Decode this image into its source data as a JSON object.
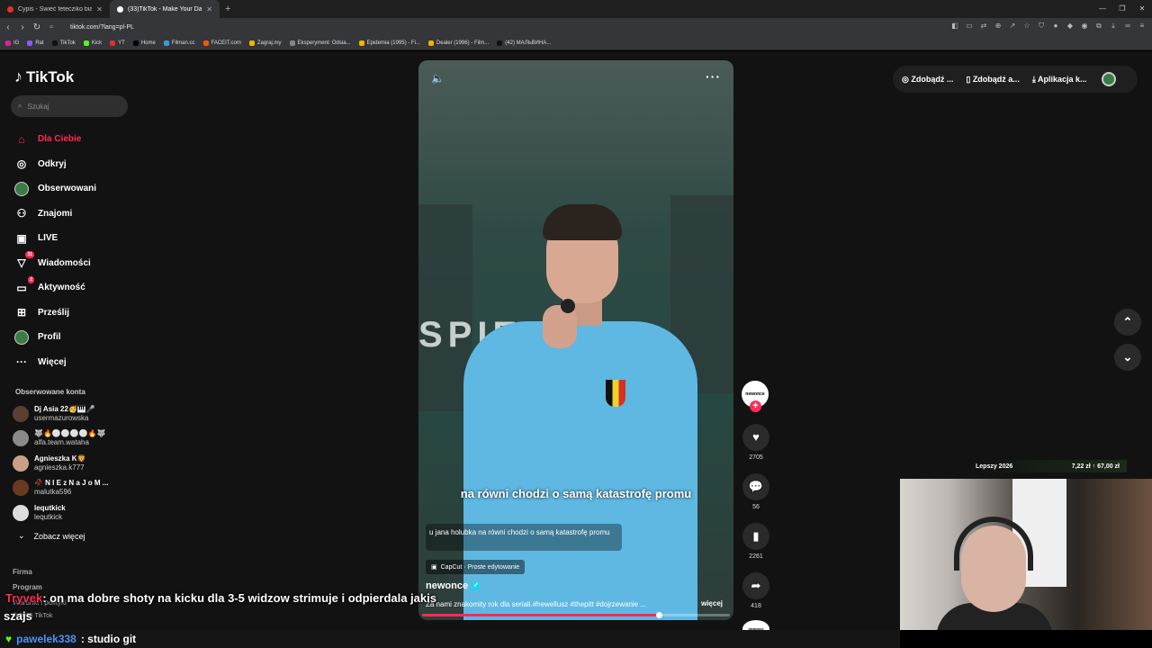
{
  "browser": {
    "tabs": [
      {
        "title": "Cypis - Świeć fetecziko biała świeć - Y",
        "color": "#e03030"
      },
      {
        "title": "(33)TikTok - Make Your Day",
        "color": "#ffffff"
      }
    ],
    "url": "tiktok.com/?lang=pl-PL",
    "bookmarks": [
      "IG",
      "Rat",
      "TikTok",
      "Kick",
      "YT",
      "Home",
      "Filman.cc",
      "FACEIT.com",
      "Zagraj.my",
      "Eksperyment: Odsia...",
      "Epidemia (1995) - Fi...",
      "Dealer (1996) - Film...",
      "(42) МАЛЬВИНА..."
    ]
  },
  "sidebar": {
    "logo": "TikTok",
    "search_placeholder": "Szukaj",
    "items": [
      {
        "label": "Dla Ciebie",
        "icon": "home-icon",
        "glyph": "⌂"
      },
      {
        "label": "Odkryj",
        "icon": "compass-icon",
        "glyph": "◎"
      },
      {
        "label": "Obserwowani",
        "icon": "following-avatar-icon",
        "glyph": "●"
      },
      {
        "label": "Znajomi",
        "icon": "friends-icon",
        "glyph": "⚇"
      },
      {
        "label": "LIVE",
        "icon": "live-icon",
        "glyph": "▣"
      },
      {
        "label": "Wiadomości",
        "icon": "messages-icon",
        "glyph": "▽",
        "badge": "31"
      },
      {
        "label": "Aktywność",
        "icon": "activity-icon",
        "glyph": "▭",
        "badge": "2"
      },
      {
        "label": "Prześlij",
        "icon": "upload-icon",
        "glyph": "⊞"
      },
      {
        "label": "Profil",
        "icon": "profile-avatar-icon",
        "glyph": "●"
      },
      {
        "label": "Więcej",
        "icon": "more-icon",
        "glyph": "···"
      }
    ],
    "followed_header": "Obserwowane konta",
    "followed": [
      {
        "name": "Dj Asia 22🥳🎹🎤",
        "handle": "usermazurowska",
        "color": "#5a4030"
      },
      {
        "name": "🐺🔥⚪⚪⚪⚪🔥🐺",
        "handle": "alfa.team.wataha",
        "color": "#8a8a8a"
      },
      {
        "name": "Agnieszka K🦁",
        "handle": "agnieszka.k777",
        "color": "#c9a08a"
      },
      {
        "name": "🥀 N I E z N a J o M ...",
        "handle": "malutka596",
        "color": "#6a3a20"
      },
      {
        "name": "lequtkick",
        "handle": "lequtkick",
        "color": "#ddd"
      }
    ],
    "see_more": "Zobacz więcej",
    "footer": [
      "Firma",
      "Program",
      "Warunki i polityki",
      "© 2025 TikTok"
    ]
  },
  "video": {
    "bg_text": "SPIEWA",
    "subtitle": "na równi chodzi o samą katastrofę promu",
    "caption": "u jana holubka na równi chodzi o samą katastrofę promu",
    "capcut": "CapCut · Proste edytowanie",
    "author": "newonce",
    "description": "Za nami znakomity rok dla seriali.#hewellusz #thepitt #dojrzewanie ...",
    "more": "więcej",
    "progress": 0.77
  },
  "actions": {
    "avatar_label": "newonce",
    "likes": "2705",
    "comments": "56",
    "saves": "2261",
    "shares": "418",
    "disc_label": "newonce"
  },
  "topbar": {
    "btn1": "Zdobądź ...",
    "btn2": "Zdobądź a...",
    "btn3": "Aplikacja k..."
  },
  "overlay": {
    "left": "Lepszy 2026",
    "right": "7,22 zł ↑ 67,00 zł"
  },
  "chat": {
    "line1_user": "Tryvek",
    "line1_text": ": on ma dobre shoty na kicku dla 3-5 widzow strimuje i odpierdala jakis",
    "line2_text": "szajs",
    "bottom_user": "pawelek338",
    "bottom_text": ": studio git"
  }
}
